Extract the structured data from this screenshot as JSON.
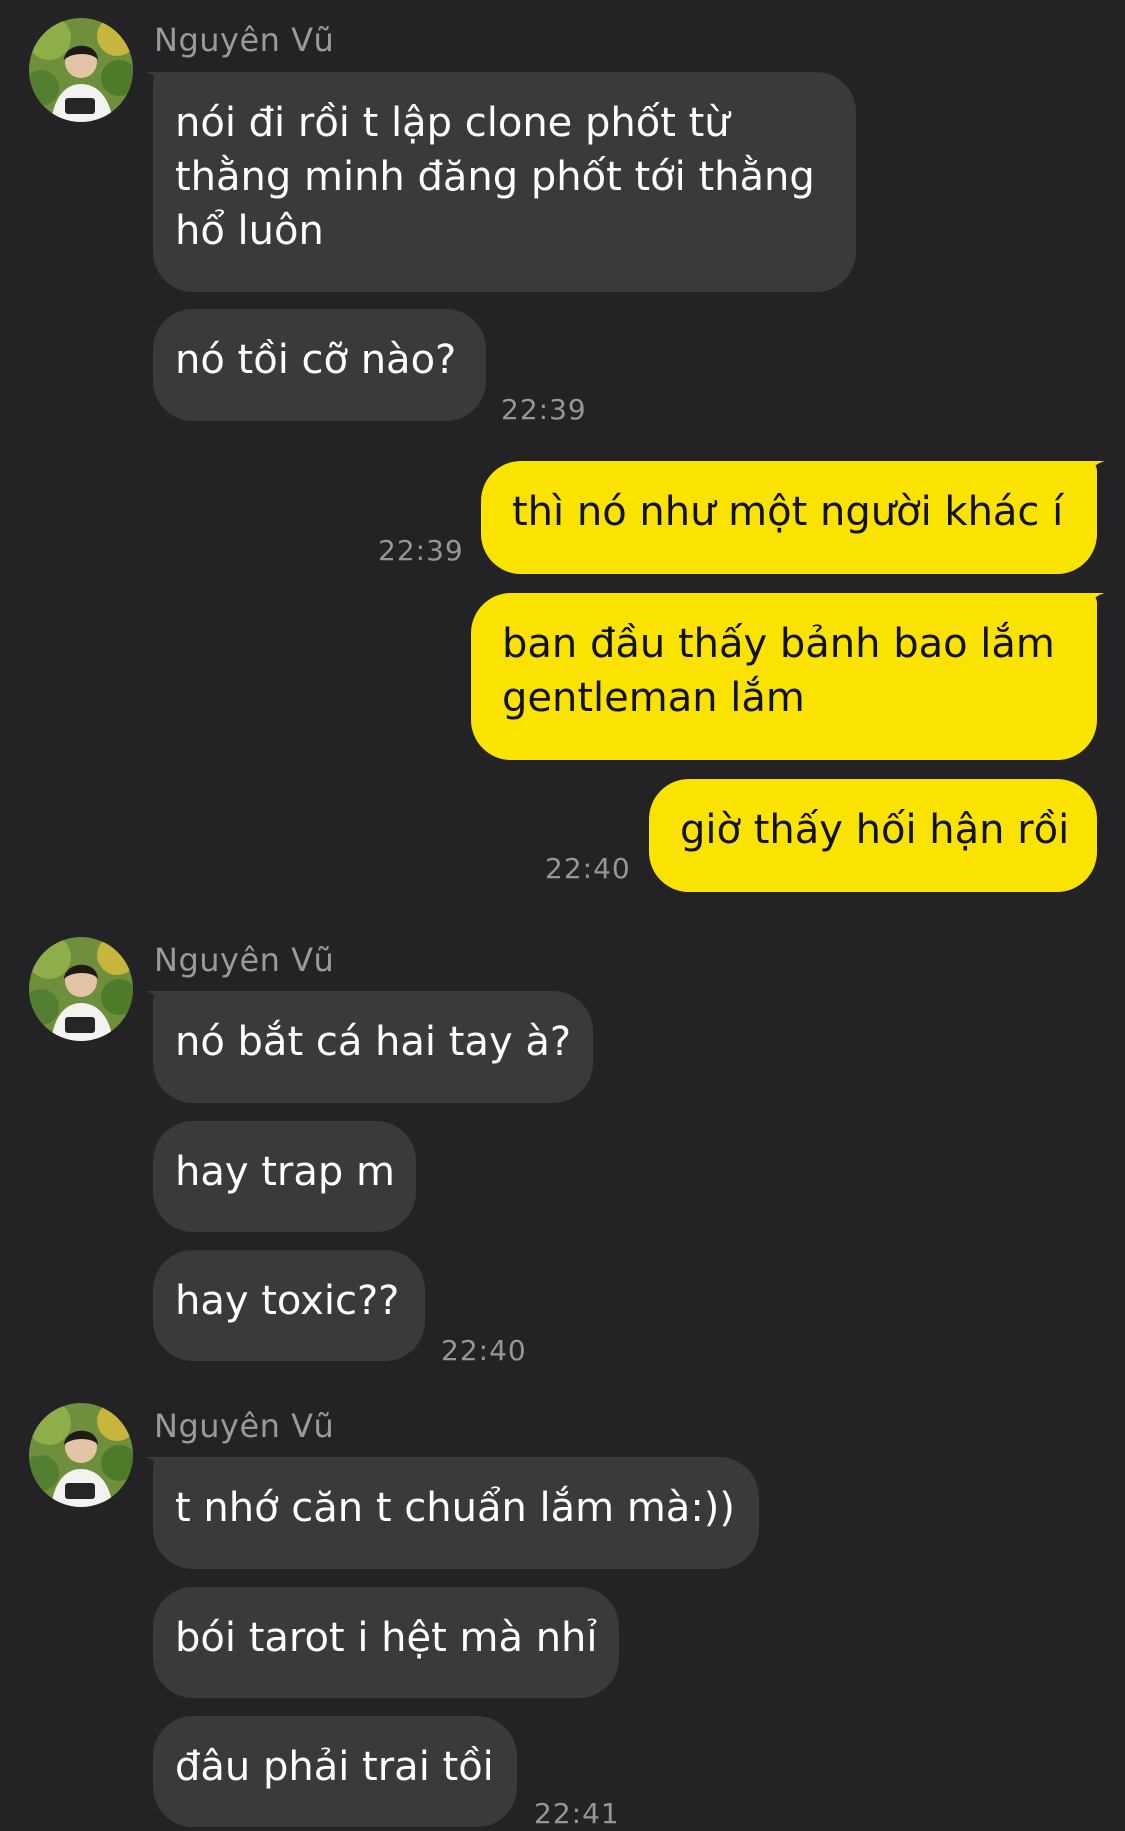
{
  "chat": {
    "groups": [
      {
        "sender": "Nguyên Vũ",
        "messages": [
          {
            "text": "nói đi rồi t lập clone phốt từ\nthằng minh đăng phốt tới thằng\nhổ luôn"
          },
          {
            "text": "nó tồi cỡ nào?",
            "time": "22:39"
          }
        ]
      },
      {
        "sender": "",
        "outgoing": true,
        "messages": [
          {
            "text": "thì nó như một người khác í",
            "time": "22:39"
          },
          {
            "text": "ban đầu thấy bảnh bao lắm\ngentleman lắm"
          },
          {
            "text": "giờ thấy hối hận rồi",
            "time": "22:40"
          }
        ]
      },
      {
        "sender": "Nguyên Vũ",
        "messages": [
          {
            "text": "nó bắt cá hai tay à?"
          },
          {
            "text": "hay trap m"
          },
          {
            "text": "hay toxic??",
            "time": "22:40"
          }
        ]
      },
      {
        "sender": "Nguyên Vũ",
        "messages": [
          {
            "text": "t nhớ căn t chuẩn lắm mà:))"
          },
          {
            "text": "bói tarot i hệt mà nhỉ"
          },
          {
            "text": "đâu phải trai tồi",
            "time": "22:41"
          }
        ]
      }
    ]
  },
  "colors": {
    "background": "#232325",
    "incoming_bubble": "#3a3a3c",
    "outgoing_bubble": "#fae300"
  },
  "icons": {
    "avatar": "avatar-photo-icon"
  }
}
